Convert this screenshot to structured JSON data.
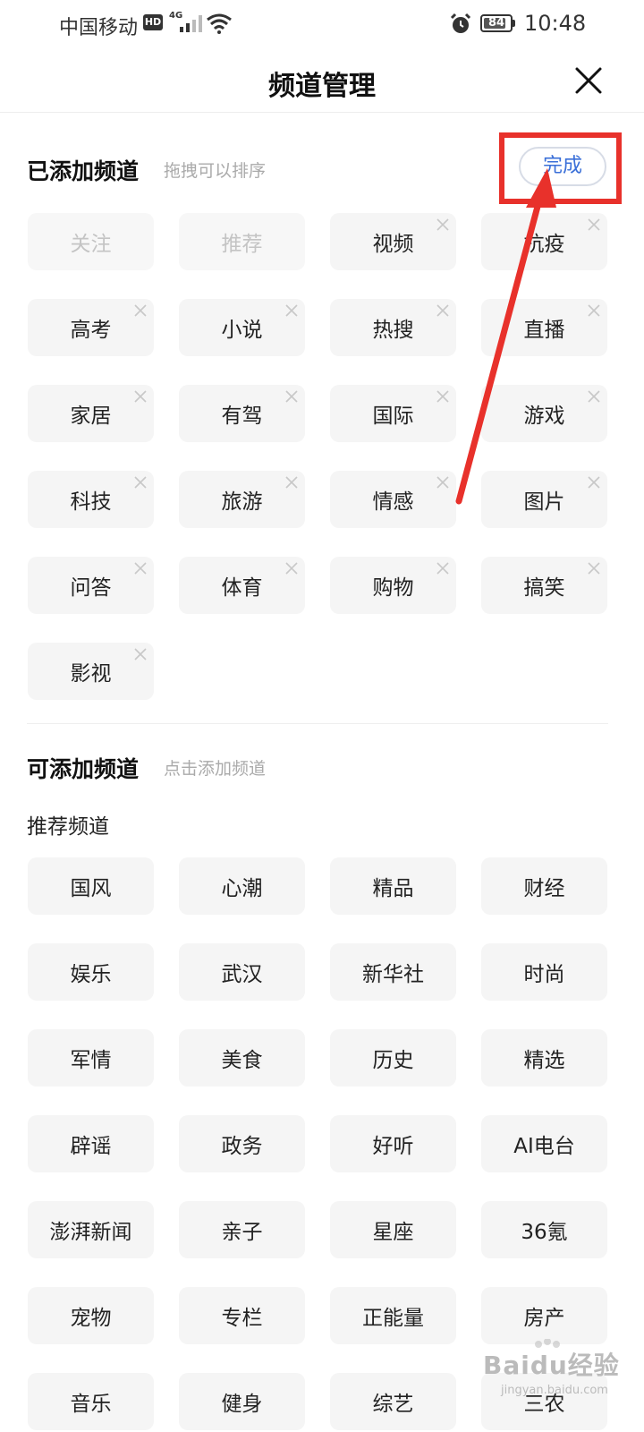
{
  "status_bar": {
    "carrier": "中国移动",
    "hd": "HD",
    "network": "4G",
    "battery": "84",
    "battery_level": 84,
    "time": "10:48"
  },
  "header": {
    "title": "频道管理"
  },
  "added_section": {
    "title": "已添加频道",
    "hint": "拖拽可以排序",
    "done_label": "完成",
    "channels": [
      {
        "label": "关注",
        "removable": false
      },
      {
        "label": "推荐",
        "removable": false
      },
      {
        "label": "视频",
        "removable": true
      },
      {
        "label": "抗疫",
        "removable": true
      },
      {
        "label": "高考",
        "removable": true
      },
      {
        "label": "小说",
        "removable": true
      },
      {
        "label": "热搜",
        "removable": true
      },
      {
        "label": "直播",
        "removable": true
      },
      {
        "label": "家居",
        "removable": true
      },
      {
        "label": "有驾",
        "removable": true
      },
      {
        "label": "国际",
        "removable": true
      },
      {
        "label": "游戏",
        "removable": true
      },
      {
        "label": "科技",
        "removable": true
      },
      {
        "label": "旅游",
        "removable": true
      },
      {
        "label": "情感",
        "removable": true
      },
      {
        "label": "图片",
        "removable": true
      },
      {
        "label": "问答",
        "removable": true
      },
      {
        "label": "体育",
        "removable": true
      },
      {
        "label": "购物",
        "removable": true
      },
      {
        "label": "搞笑",
        "removable": true
      },
      {
        "label": "影视",
        "removable": true
      }
    ]
  },
  "available_section": {
    "title": "可添加频道",
    "hint": "点击添加频道",
    "subtitle": "推荐频道",
    "channels": [
      "国风",
      "心潮",
      "精品",
      "财经",
      "娱乐",
      "武汉",
      "新华社",
      "时尚",
      "军情",
      "美食",
      "历史",
      "精选",
      "辟谣",
      "政务",
      "好听",
      "AI电台",
      "澎湃新闻",
      "亲子",
      "星座",
      "36氪",
      "宠物",
      "专栏",
      "正能量",
      "房产",
      "音乐",
      "健身",
      "综艺",
      "三农"
    ]
  },
  "watermark": {
    "text": "Baidu经验",
    "sub": "jingyan.baidu.com"
  },
  "colors": {
    "accent": "#3a6fd8",
    "annotation": "#e8312b",
    "tile_bg": "#f5f5f5"
  }
}
